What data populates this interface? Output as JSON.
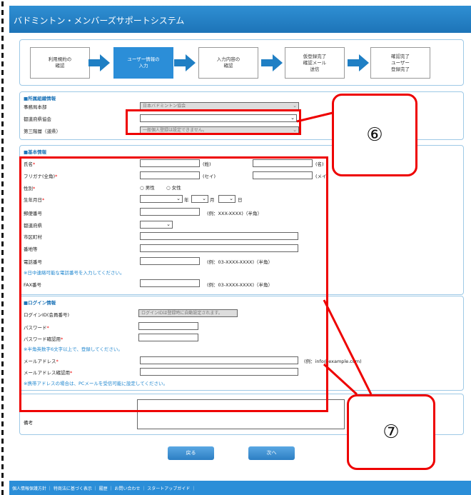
{
  "header": {
    "title": "バドミントン・メンバーズサポートシステム"
  },
  "steps": [
    {
      "line1": "利用規約の",
      "line2": "確認",
      "line3": "",
      "active": false
    },
    {
      "line1": "ユーザー情報の",
      "line2": "入力",
      "line3": "",
      "active": true
    },
    {
      "line1": "入力内容の",
      "line2": "確認",
      "line3": "",
      "active": false
    },
    {
      "line1": "仮登録完了",
      "line2": "確認メール",
      "line3": "送信",
      "active": false
    },
    {
      "line1": "確認完了",
      "line2": "ユーザー",
      "line3": "登録完了",
      "active": false
    }
  ],
  "org": {
    "title": "■所属組織情報",
    "office_label": "事務局本部",
    "office_value": "日本バドミントン協会",
    "prefecture_label": "都道府県協会",
    "third_label": "第三階層（道県）",
    "third_value": "一般個人登録は設定できません。"
  },
  "basic": {
    "title": "■基本情報",
    "name_label": "氏名",
    "sei": "(姓)",
    "mei": "(名)",
    "furigana_label": "フリガナ(全角)",
    "sei_kana": "(セイ)",
    "mei_kana": "(メイ)",
    "gender_label": "性別",
    "male": "男性",
    "female": "女性",
    "birth_label": "生年月日",
    "year": "年",
    "month": "月",
    "day": "日",
    "zip_label": "郵便番号",
    "zip_hint": "(例：XXX-XXXX)（半角）",
    "pref_label": "都道府県",
    "city_label": "市区町村",
    "address_label": "番地等",
    "phone_label": "電話番号",
    "phone_hint": "(例：03-XXXX-XXXX)（半角）",
    "phone_note": "※日中連絡可能な電話番号を入力してください。",
    "fax_label": "FAX番号",
    "fax_hint": "(例：03-XXXX-XXXX)（半角）"
  },
  "login": {
    "title": "■ログイン情報",
    "id_label": "ログインID(会員番号)",
    "id_value": "ログインIDは登録時に自動設定されます。",
    "password_label": "パスワード",
    "password_confirm_label": "パスワード確認用",
    "password_note": "※半角英数字6文字以上で、登録してください。",
    "email_label": "メールアドレス",
    "email_hint": "(例：info@example.com)",
    "email_confirm_label": "メールアドレス確認用",
    "email_note": "※携帯アドレスの場合は、PCメールを受信可能に設定してください。"
  },
  "remarks": {
    "label": "備考"
  },
  "buttons": {
    "back": "戻る",
    "next": "次へ"
  },
  "footer": {
    "links": "個人情報保護方針 ｜ 特商法に基づく表示 ｜ 履歴 ｜ お問い合わせ ｜ スタートアップガイド ｜"
  },
  "callouts": {
    "six": "⑥",
    "seven": "⑦"
  },
  "colors": {
    "accent": "#2b8ed8",
    "highlight": "#e00000"
  }
}
